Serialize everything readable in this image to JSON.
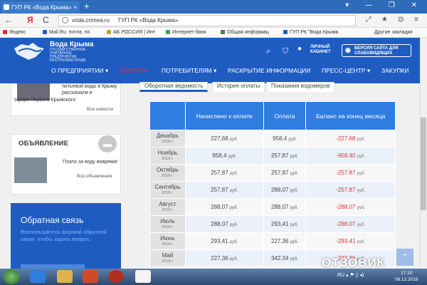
{
  "browser": {
    "tab_title": "ГУП РК «Вода Крыма»",
    "tab_close": "×",
    "new_tab": "+",
    "window_controls": "▾ — ❐ ✕",
    "nav": {
      "back": "←",
      "yandex": "Я",
      "reload": "C"
    },
    "url": "voda.crimea.ru",
    "page_title": "ГУП РК «Вода Крыма»",
    "toolbar_icons": "⤢ ★ ⚙ ≡",
    "bookmarks": [
      {
        "label": "Яндекс",
        "color": "#e03030"
      },
      {
        "label": "Mail.Ru: почта, по",
        "color": "#1f5cc2"
      },
      {
        "label": "АБ РОССИЯ | Инт",
        "color": "#c8a020"
      },
      {
        "label": "Интернет-банк",
        "color": "#3aa35a"
      },
      {
        "label": "Общая информац",
        "color": "#3a8a3a"
      },
      {
        "label": "ГУП РК \"Вода Крыма",
        "color": "#1f5cc2"
      }
    ],
    "bookmarks_other": "Другие закладки"
  },
  "site": {
    "brand_name": "Вода Крыма",
    "brand_sub": "Государственное унитарное предприятие Республики Крым",
    "icons": {
      "search": "⌕",
      "shield": "⛉",
      "user": "👤",
      "eye": "◉"
    },
    "personal_account": "Личный кабинет",
    "vision_version": "Версия сайта для слабовидящих",
    "menu": [
      "О ПРЕДПРИЯТИИ ▾",
      "УСЛУГИ ▾",
      "ПОТРЕБИТЕЛЯМ ▾",
      "РАСКРЫТИЕ ИНФОРМАЦИИ",
      "ПРЕСС-ЦЕНТР ▾",
      "ЗАКУПКИ"
    ],
    "accent": "#1f5cc2",
    "active_menu_color": "#e03030"
  },
  "sidebar": {
    "news_text_right": "питьевой воды в Крыму рассказали в",
    "news_text_bottom": "эфире Первого Крымского",
    "news_all": "Все новости",
    "ann_title": "ОБЪЯВЛЕНИЕ",
    "ann_text": "Плати за воду вовремя!",
    "ann_all": "Все объявления",
    "feedback_title": "Обратная связь",
    "feedback_text": "Воспользуйтесь формой обратной связи, чтобы задать вопрос."
  },
  "tabs": [
    "Оборотная ведомость",
    "История оплаты",
    "Показания водомеров"
  ],
  "table": {
    "headers": [
      "",
      "Начислено к оплате",
      "Оплата",
      "Баланс на конец месяца"
    ],
    "currency": "руб.",
    "rows": [
      {
        "month": "Декабрь",
        "year": "2018 г.",
        "charged": "227,68",
        "paid": "958,4",
        "balance": "-227.68"
      },
      {
        "month": "Ноябрь",
        "year": "2018 г.",
        "charged": "958,4",
        "paid": "257,87",
        "balance": "-958.40"
      },
      {
        "month": "Октябрь",
        "year": "2018 г.",
        "charged": "257,87",
        "paid": "257,87",
        "balance": "-257.87"
      },
      {
        "month": "Сентябрь",
        "year": "2018 г.",
        "charged": "257,87",
        "paid": "288,07",
        "balance": "-257.87"
      },
      {
        "month": "Август",
        "year": "2018 г.",
        "charged": "288,07",
        "paid": "288,07",
        "balance": "-288.07"
      },
      {
        "month": "Июль",
        "year": "2018 г.",
        "charged": "288,07",
        "paid": "293,41",
        "balance": "-288.07"
      },
      {
        "month": "Июнь",
        "year": "2018 г.",
        "charged": "293,41",
        "paid": "227,36",
        "balance": "-293.41"
      },
      {
        "month": "Май",
        "year": "2018 г.",
        "charged": "227,36",
        "paid": "342,34",
        "balance": "-227.36"
      }
    ]
  },
  "scroll_top": "⌃",
  "taskbar": {
    "tray": "RU ▴ ⚑ ▯ ◂)",
    "time": "17:10",
    "date": "06.12.2018"
  },
  "watermark": "ОТЗОВИК"
}
